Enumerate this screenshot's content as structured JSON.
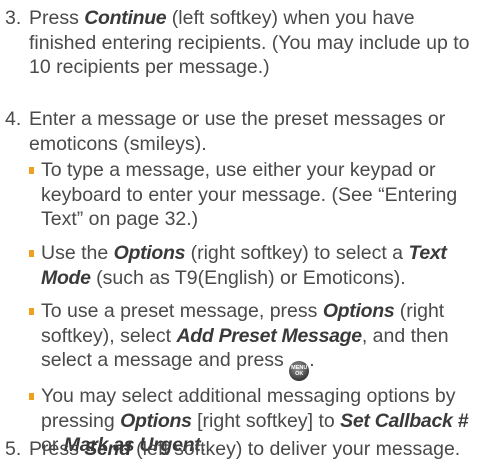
{
  "colors": {
    "bullet": "#f0a020",
    "text": "#4a4a4a"
  },
  "steps": [
    {
      "num": "3.",
      "pre": "Press ",
      "em": "Continue",
      "post": " (left softkey) when you have finished entering recipients. (You may include up to 10 recipients per message.)"
    },
    {
      "num": "4.",
      "text": "Enter a message or use the preset messages or emoticons (smileys)."
    },
    {
      "num": "5.",
      "pre": "Press ",
      "em": "Send",
      "post": " (left softkey) to deliver your message."
    }
  ],
  "bullets": [
    {
      "text": "To type a message, use either your keypad or keyboard to enter your message. (See “Entering Text” on page 32.)"
    },
    {
      "p1": "Use the ",
      "e1": "Options",
      "p2": " (right softkey) to select a ",
      "e2": "Text Mode",
      "p3": " (such as T9(English) or Emoticons)."
    },
    {
      "p1": "To use a preset message, press ",
      "e1": "Options",
      "p2": " (right softkey), select ",
      "e2": "Add Preset Message",
      "p3": ", and then select a message and press ",
      "key_top": "MENU",
      "key_bottom": "OK",
      "p4": "."
    },
    {
      "p1": "You may select additional messaging options by pressing ",
      "e1": "Options",
      "p2": " [right softkey] to ",
      "e2": "Set Callback #",
      "p3": " or ",
      "e3": "Mark as Urgent",
      "p4": "."
    }
  ]
}
